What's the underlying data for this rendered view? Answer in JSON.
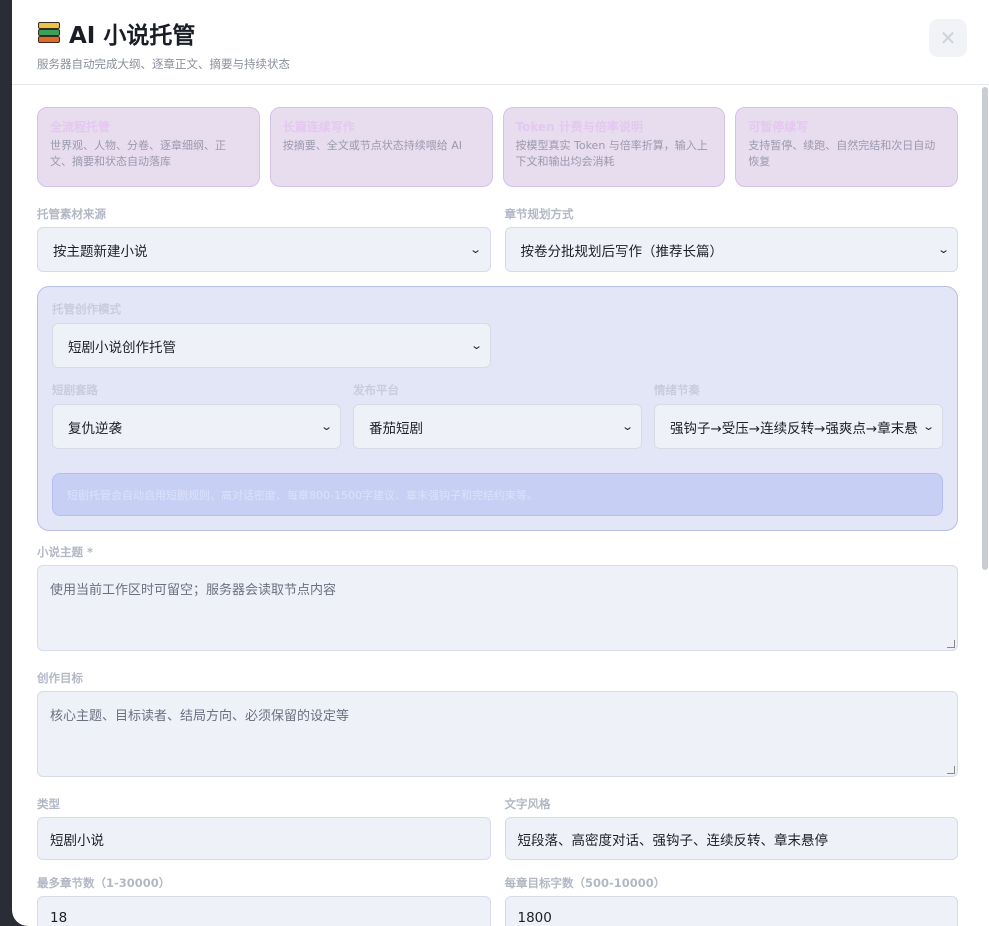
{
  "header": {
    "title": "AI 小说托管",
    "subtitle": "服务器自动完成大纲、逐章正文、摘要与持续状态",
    "close_symbol": "✕",
    "icon": "books-icon"
  },
  "cards": [
    {
      "title": "全流程托管",
      "desc": "世界观、人物、分卷、逐章细纲、正文、摘要和状态自动落库"
    },
    {
      "title": "长篇连续写作",
      "desc": "按摘要、全文或节点状态持续喂给 AI"
    },
    {
      "title": "Token 计费与倍率说明",
      "desc": "按模型真实 Token 与倍率折算，输入上下文和输出均会消耗"
    },
    {
      "title": "可暂停续写",
      "desc": "支持暂停、续跑、自然完结和次日自动恢复"
    }
  ],
  "source": {
    "label": "托管素材来源",
    "value": "按主题新建小说"
  },
  "planning": {
    "label": "章节规划方式",
    "value": "按卷分批规划后写作（推荐长篇）"
  },
  "mode": {
    "label": "托管创作模式",
    "value": "短剧小说创作托管",
    "routine": {
      "label": "短剧套路",
      "value": "复仇逆袭"
    },
    "platform": {
      "label": "发布平台",
      "value": "番茄短剧"
    },
    "rhythm": {
      "label": "情绪节奏",
      "value": "强钩子→受压→连续反转→强爽点→章末悬"
    },
    "notice": "短剧托管会自动启用短剧规则、高对话密度、每章800-1500字建议、章末强钩子和完结约束等。"
  },
  "theme": {
    "label": "小说主题 *",
    "placeholder": "使用当前工作区时可留空；服务器会读取节点内容"
  },
  "goal": {
    "label": "创作目标",
    "placeholder": "核心主题、目标读者、结局方向、必须保留的设定等"
  },
  "genre": {
    "label": "类型",
    "value": "短剧小说"
  },
  "style": {
    "label": "文字风格",
    "value": "短段落、高密度对话、强钩子、连续反转、章末悬停"
  },
  "max_chapters": {
    "label": "最多章节数（1-30000）",
    "value": "18"
  },
  "words_per_chapter": {
    "label": "每章目标字数（500-10000）",
    "value": "1800"
  }
}
